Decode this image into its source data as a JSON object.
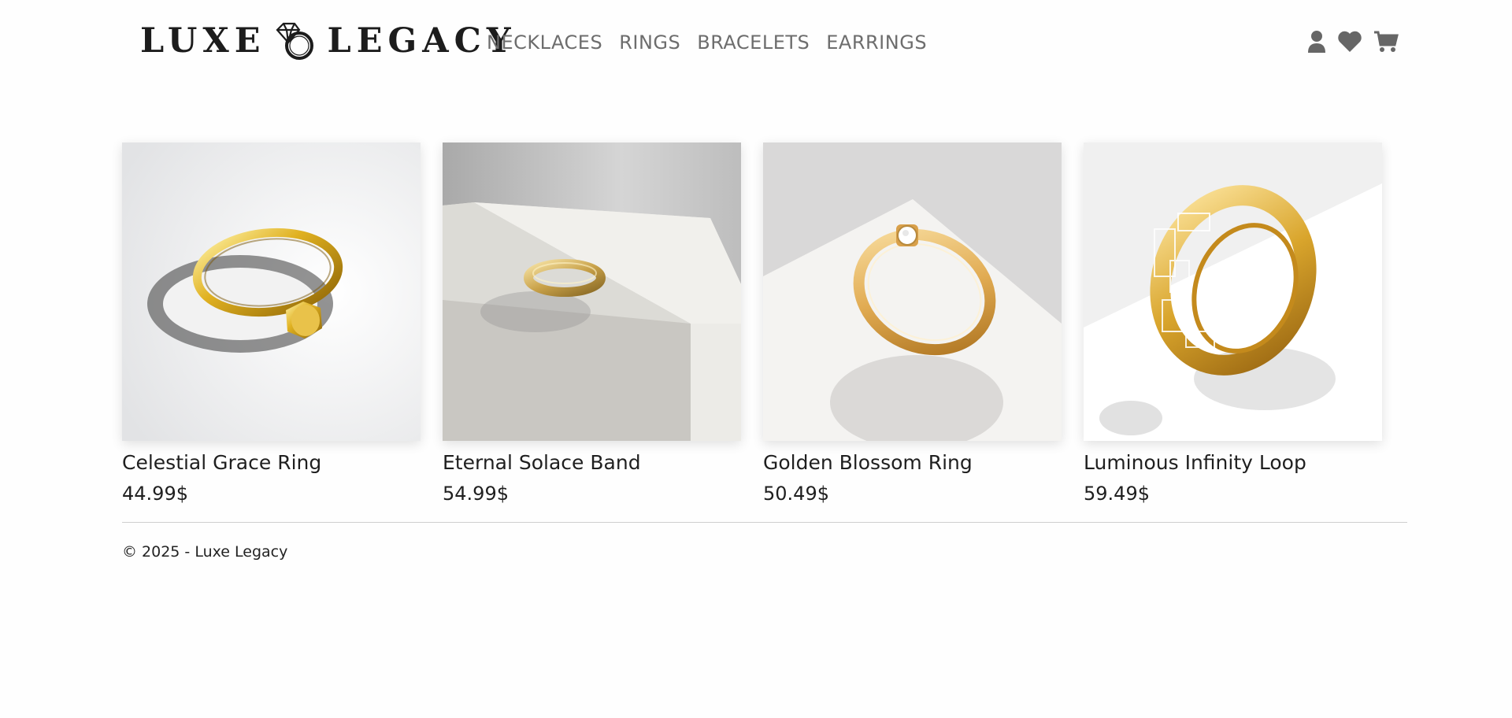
{
  "brand": {
    "name_left": "LUXE",
    "name_right": "LEGACY",
    "icon": "diamond-ring-icon"
  },
  "nav": {
    "items": [
      {
        "label": "NECKLACES"
      },
      {
        "label": "RINGS"
      },
      {
        "label": "BRACELETS"
      },
      {
        "label": "EARRINGS"
      }
    ]
  },
  "header_icons": [
    "user-icon",
    "heart-icon",
    "cart-icon"
  ],
  "products": [
    {
      "name": "Celestial Grace Ring",
      "price": "44.99$",
      "image": "plain-gold-ring-with-disc"
    },
    {
      "name": "Eternal Solace Band",
      "price": "54.99$",
      "image": "gold-band-on-white-block"
    },
    {
      "name": "Golden Blossom Ring",
      "price": "50.49$",
      "image": "gold-solitaire-ring"
    },
    {
      "name": "Luminous Infinity Loop",
      "price": "59.49$",
      "image": "gold-filigree-band"
    }
  ],
  "footer": {
    "text": "© 2025 - Luxe Legacy"
  },
  "colors": {
    "nav_text": "#6d6d6d",
    "icon": "#666666",
    "gold": "#d4a634"
  }
}
